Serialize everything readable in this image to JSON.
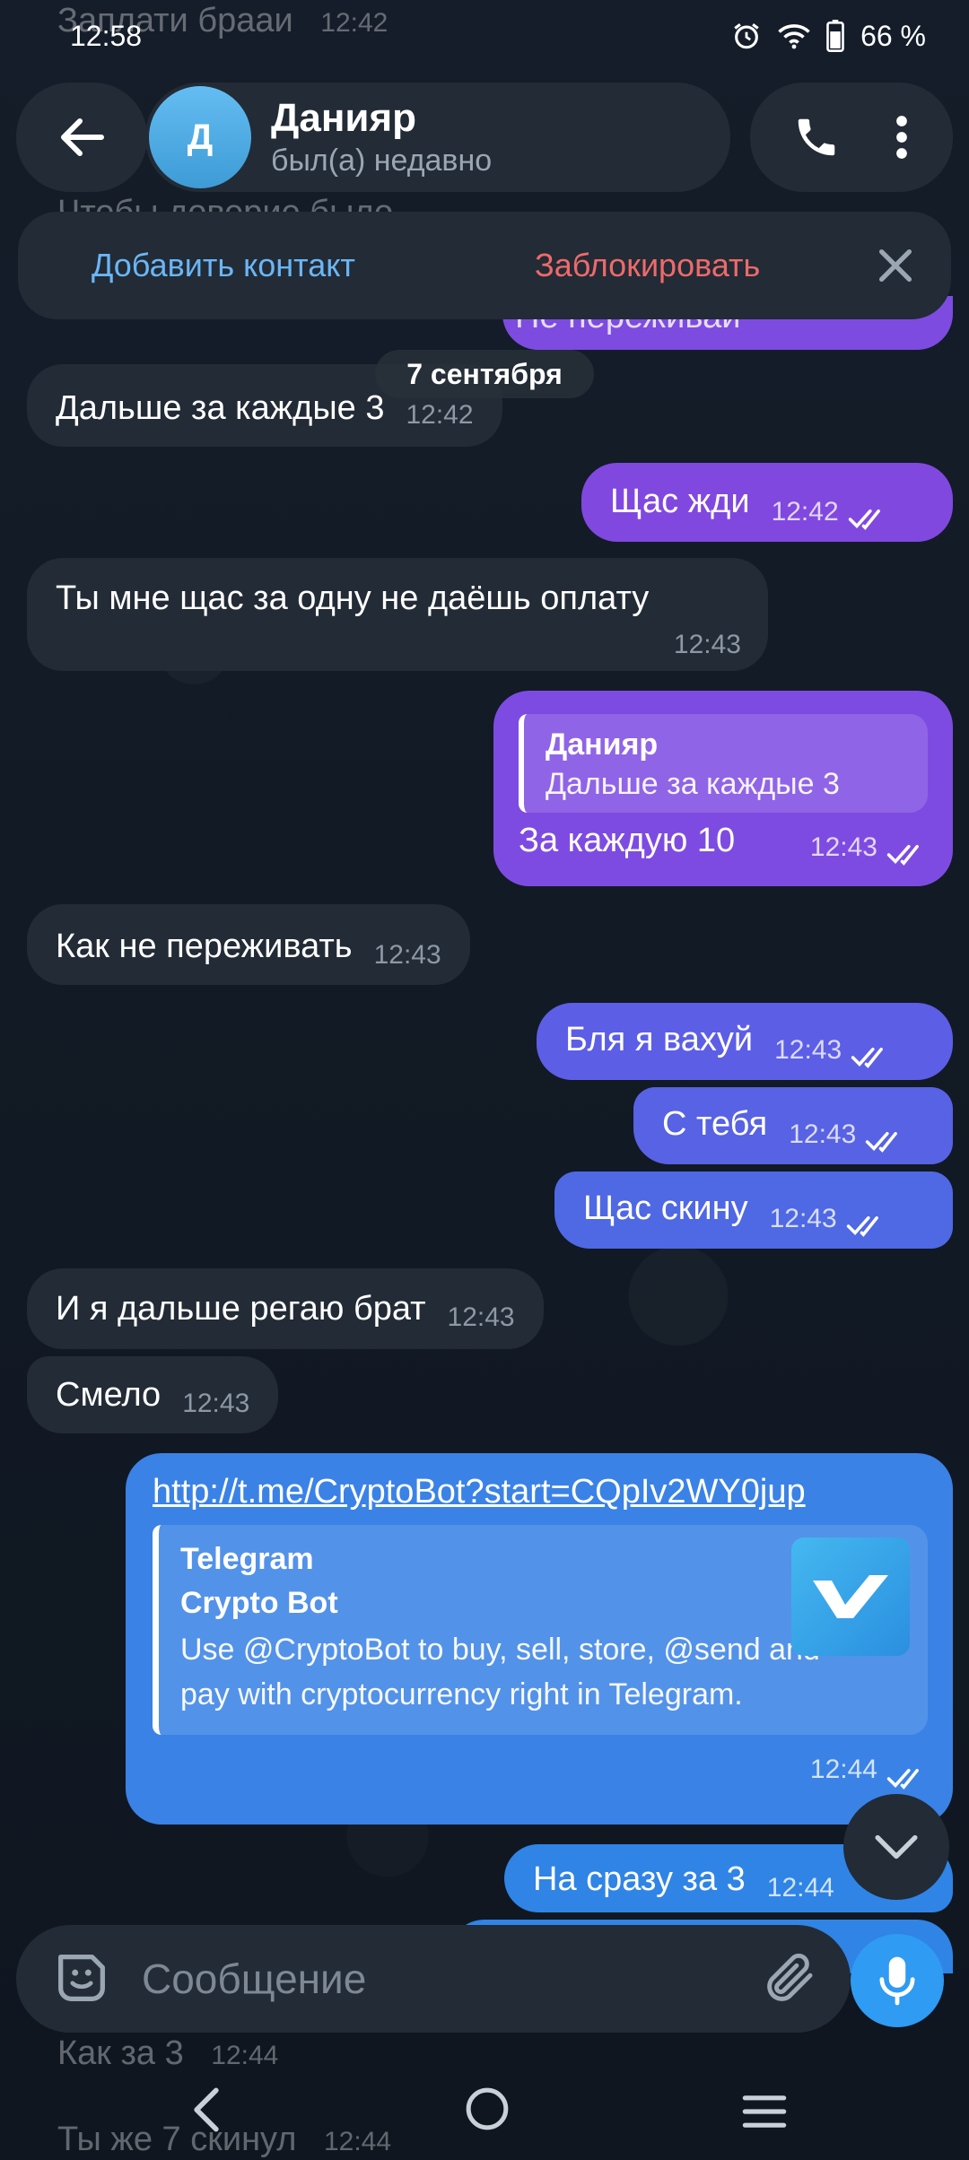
{
  "status": {
    "time": "12:58",
    "battery": "66 %"
  },
  "ghost": {
    "top_text": "Заплати брааи",
    "top_time": "12:42",
    "mid_text": "Чтобы доверие было",
    "behind_action_text": "Не переживай",
    "behind_action_time": "12:42",
    "bottom1_text": "Как за 3",
    "bottom1_time": "12:44",
    "bottom2_text": "Ты же 7 скинул",
    "bottom2_time": "12:44"
  },
  "header": {
    "avatar_letter": "Д",
    "contact_name": "Данияр",
    "contact_status": "был(а) недавно"
  },
  "action_bar": {
    "add_contact": "Добавить контакт",
    "block": "Заблокировать"
  },
  "date_chip": "7 сентября",
  "messages": [
    {
      "dir": "in",
      "text": "Дальше за каждые 3",
      "time": "12:42"
    },
    {
      "dir": "out",
      "text": "Щас жди",
      "time": "12:42"
    },
    {
      "dir": "in",
      "text": "Ты мне щас за одну не даёшь оплату",
      "time": "12:43"
    },
    {
      "dir": "out",
      "reply_name": "Данияр",
      "reply_text": "Дальше за каждые 3",
      "text": "За каждую 10",
      "time": "12:43"
    },
    {
      "dir": "in",
      "text": "Как не переживать",
      "time": "12:43"
    },
    {
      "dir": "out",
      "text": "Бля я вахуй",
      "time": "12:43"
    },
    {
      "dir": "out",
      "text": "С тебя",
      "time": "12:43"
    },
    {
      "dir": "out",
      "text": "Щас скину",
      "time": "12:43"
    },
    {
      "dir": "in",
      "text": "И я дальше регаю брат",
      "time": "12:43"
    },
    {
      "dir": "in",
      "text": "Смело",
      "time": "12:43"
    },
    {
      "dir": "out",
      "link": "http://t.me/CryptoBot?start=CQpIv2WY0jup",
      "preview_site": "Telegram",
      "preview_title": "Crypto Bot",
      "preview_desc": "Use @CryptoBot to buy, sell, store, @send and pay with cryptocurrency right in Telegram.",
      "time": "12:44"
    },
    {
      "dir": "out",
      "text": "На сразу за 3",
      "time": "12:44"
    }
  ],
  "composer": {
    "placeholder": "Сообщение"
  },
  "colors": {
    "accent": "#2f9bf2",
    "incoming_bubble": "#222b36",
    "outgoing_top": "#8a4be0",
    "outgoing_bottom": "#2f84e6",
    "block_red": "#ee6a6a",
    "link_blue": "#6bb6f5"
  }
}
